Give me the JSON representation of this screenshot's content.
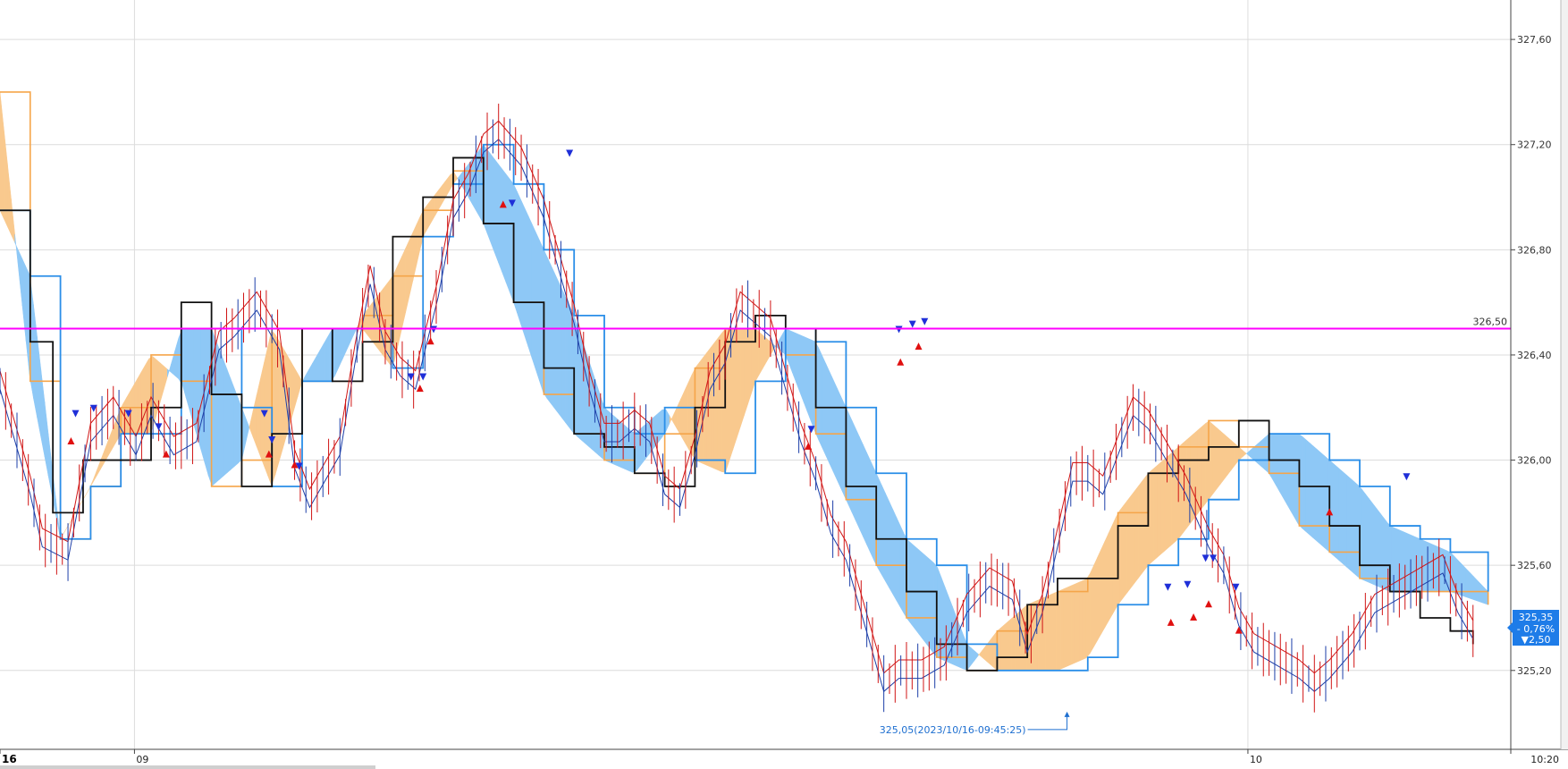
{
  "colors": {
    "grid": "#dcdcdc",
    "kumo_bull": "#f9c98e",
    "kumo_bear": "#8ec8f6",
    "span_a": "#f5a54a",
    "span_b": "#2a8ee8",
    "base_line": "#111111",
    "conversion": "#e01010",
    "price_up": "#d01515",
    "price_down": "#1d3fa8",
    "reference": "#ff00ff",
    "marker_buy": "#e01010",
    "marker_sell": "#1f2fd8",
    "badge_bg": "#1e7ce8",
    "axis": "#444444",
    "annotation": "#1e6fd0"
  },
  "chart_data": {
    "type": "line",
    "y_axis": {
      "ticks": [
        "327,60",
        "327,20",
        "326,80",
        "326,40",
        "326,00",
        "325,60",
        "325,20"
      ],
      "tick_values": [
        327.6,
        327.2,
        326.8,
        326.4,
        326.0,
        325.6,
        325.2
      ],
      "range": [
        324.9,
        327.75
      ]
    },
    "x_axis": {
      "labels": [
        {
          "text": "16",
          "pos": 0.0,
          "bold": true
        },
        {
          "text": "09",
          "pos": 0.089
        },
        {
          "text": "10",
          "pos": 0.826
        },
        {
          "text": "10:20",
          "pos": 1.0
        }
      ]
    },
    "reference_line": {
      "value": 326.5,
      "label": "326,50"
    },
    "low_annotation": {
      "text": "325,05(2023/10/16-09:45:25)",
      "value": 325.05,
      "pos": 0.711
    },
    "last_price": {
      "value": "325,35",
      "change_pct": "- 0,76%",
      "change": "▼2,50"
    },
    "series": [
      {
        "role": "price",
        "x": [
          0.0,
          0.02,
          0.028,
          0.045,
          0.06,
          0.075,
          0.09,
          0.1,
          0.115,
          0.13,
          0.145,
          0.155,
          0.17,
          0.185,
          0.195,
          0.205,
          0.215,
          0.225,
          0.235,
          0.245,
          0.255,
          0.265,
          0.275,
          0.29,
          0.3,
          0.31,
          0.32,
          0.33,
          0.345,
          0.36,
          0.37,
          0.38,
          0.39,
          0.4,
          0.41,
          0.42,
          0.43,
          0.44,
          0.45,
          0.46,
          0.47,
          0.48,
          0.49,
          0.5,
          0.51,
          0.52,
          0.53,
          0.54,
          0.55,
          0.56,
          0.575,
          0.585,
          0.595,
          0.61,
          0.625,
          0.64,
          0.655,
          0.67,
          0.68,
          0.69,
          0.7,
          0.71,
          0.72,
          0.73,
          0.74,
          0.75,
          0.76,
          0.775,
          0.785,
          0.8,
          0.81,
          0.82,
          0.83,
          0.845,
          0.86,
          0.87,
          0.88,
          0.895,
          0.91,
          0.925,
          0.94,
          0.955,
          0.965,
          0.975
        ],
        "y": [
          326.3,
          325.9,
          325.7,
          325.65,
          326.1,
          326.2,
          326.05,
          326.2,
          326.05,
          326.1,
          326.45,
          326.5,
          326.6,
          326.45,
          326.0,
          325.85,
          325.95,
          326.05,
          326.4,
          326.7,
          326.45,
          326.35,
          326.3,
          326.65,
          326.95,
          327.05,
          327.2,
          327.25,
          327.15,
          326.95,
          326.75,
          326.55,
          326.3,
          326.1,
          326.1,
          326.15,
          326.1,
          325.9,
          325.85,
          326.05,
          326.3,
          326.4,
          326.6,
          326.55,
          326.5,
          326.3,
          326.1,
          325.95,
          325.75,
          325.65,
          325.35,
          325.15,
          325.2,
          325.2,
          325.25,
          325.45,
          325.55,
          325.5,
          325.3,
          325.45,
          325.7,
          325.95,
          325.95,
          325.9,
          326.05,
          326.2,
          326.15,
          326.0,
          325.9,
          325.7,
          325.6,
          325.4,
          325.3,
          325.25,
          325.2,
          325.15,
          325.2,
          325.3,
          325.45,
          325.5,
          325.55,
          325.6,
          325.45,
          325.35
        ]
      },
      {
        "role": "base_line",
        "x": [
          0.0,
          0.02,
          0.035,
          0.055,
          0.08,
          0.1,
          0.12,
          0.14,
          0.16,
          0.18,
          0.2,
          0.22,
          0.24,
          0.26,
          0.28,
          0.3,
          0.32,
          0.34,
          0.36,
          0.38,
          0.4,
          0.42,
          0.44,
          0.46,
          0.48,
          0.5,
          0.52,
          0.54,
          0.56,
          0.58,
          0.6,
          0.62,
          0.64,
          0.66,
          0.68,
          0.7,
          0.72,
          0.74,
          0.76,
          0.78,
          0.8,
          0.82,
          0.84,
          0.86,
          0.88,
          0.9,
          0.92,
          0.94,
          0.96,
          0.975
        ],
        "y": [
          326.95,
          326.45,
          325.8,
          326.0,
          326.0,
          326.2,
          326.6,
          326.25,
          325.9,
          326.1,
          326.5,
          326.3,
          326.45,
          326.85,
          327.0,
          327.15,
          326.9,
          326.6,
          326.35,
          326.1,
          326.05,
          325.95,
          325.9,
          326.2,
          326.45,
          326.55,
          326.5,
          326.2,
          325.9,
          325.7,
          325.5,
          325.3,
          325.2,
          325.25,
          325.45,
          325.55,
          325.55,
          325.75,
          325.95,
          326.0,
          326.05,
          326.15,
          326.0,
          325.9,
          325.75,
          325.6,
          325.5,
          325.4,
          325.35,
          325.3
        ]
      },
      {
        "role": "span_a",
        "x": [
          0.0,
          0.02,
          0.04,
          0.06,
          0.08,
          0.1,
          0.12,
          0.14,
          0.16,
          0.18,
          0.2,
          0.22,
          0.24,
          0.26,
          0.28,
          0.3,
          0.32,
          0.34,
          0.36,
          0.38,
          0.4,
          0.42,
          0.44,
          0.46,
          0.48,
          0.5,
          0.52,
          0.54,
          0.56,
          0.58,
          0.6,
          0.62,
          0.64,
          0.66,
          0.68,
          0.7,
          0.72,
          0.74,
          0.76,
          0.78,
          0.8,
          0.82,
          0.84,
          0.86,
          0.88,
          0.9,
          0.92,
          0.94,
          0.96,
          0.985
        ],
        "y": [
          327.4,
          326.3,
          325.7,
          325.9,
          326.2,
          326.4,
          326.3,
          325.9,
          326.0,
          326.5,
          326.3,
          326.3,
          326.55,
          326.7,
          326.95,
          327.1,
          326.9,
          326.6,
          326.25,
          326.1,
          326.0,
          325.95,
          326.1,
          326.35,
          326.5,
          326.5,
          326.4,
          326.1,
          325.85,
          325.6,
          325.4,
          325.25,
          325.2,
          325.35,
          325.45,
          325.5,
          325.55,
          325.8,
          325.95,
          326.05,
          326.15,
          326.05,
          325.95,
          325.75,
          325.65,
          325.55,
          325.5,
          325.5,
          325.5,
          325.45
        ]
      },
      {
        "role": "span_b",
        "x": [
          0.0,
          0.02,
          0.04,
          0.06,
          0.08,
          0.1,
          0.12,
          0.14,
          0.16,
          0.18,
          0.2,
          0.22,
          0.24,
          0.26,
          0.28,
          0.3,
          0.32,
          0.34,
          0.36,
          0.38,
          0.4,
          0.42,
          0.44,
          0.46,
          0.48,
          0.5,
          0.52,
          0.54,
          0.56,
          0.58,
          0.6,
          0.62,
          0.64,
          0.66,
          0.68,
          0.7,
          0.72,
          0.74,
          0.76,
          0.78,
          0.8,
          0.82,
          0.84,
          0.86,
          0.88,
          0.9,
          0.92,
          0.94,
          0.96,
          0.985
        ],
        "y": [
          326.95,
          326.7,
          325.7,
          325.9,
          326.1,
          326.1,
          326.5,
          326.5,
          326.2,
          325.9,
          326.3,
          326.5,
          326.5,
          326.35,
          326.85,
          327.05,
          327.2,
          327.05,
          326.8,
          326.55,
          326.2,
          326.1,
          326.2,
          326.0,
          325.95,
          326.3,
          326.5,
          326.45,
          326.2,
          325.95,
          325.7,
          325.6,
          325.3,
          325.2,
          325.2,
          325.2,
          325.25,
          325.45,
          325.6,
          325.7,
          325.85,
          326.0,
          326.1,
          326.1,
          326.0,
          325.9,
          325.75,
          325.7,
          325.65,
          325.5
        ]
      }
    ],
    "markers_buy": [
      {
        "pos": 0.047,
        "value": 326.07
      },
      {
        "pos": 0.11,
        "value": 326.02
      },
      {
        "pos": 0.178,
        "value": 326.02
      },
      {
        "pos": 0.195,
        "value": 325.98
      },
      {
        "pos": 0.278,
        "value": 326.27
      },
      {
        "pos": 0.285,
        "value": 326.45
      },
      {
        "pos": 0.333,
        "value": 326.97
      },
      {
        "pos": 0.535,
        "value": 326.05
      },
      {
        "pos": 0.596,
        "value": 326.37
      },
      {
        "pos": 0.608,
        "value": 326.43
      },
      {
        "pos": 0.775,
        "value": 325.38
      },
      {
        "pos": 0.79,
        "value": 325.4
      },
      {
        "pos": 0.8,
        "value": 325.45
      },
      {
        "pos": 0.82,
        "value": 325.35
      },
      {
        "pos": 0.88,
        "value": 325.8
      }
    ],
    "markers_sell": [
      {
        "pos": 0.05,
        "value": 326.18
      },
      {
        "pos": 0.062,
        "value": 326.2
      },
      {
        "pos": 0.085,
        "value": 326.18
      },
      {
        "pos": 0.105,
        "value": 326.13
      },
      {
        "pos": 0.175,
        "value": 326.18
      },
      {
        "pos": 0.18,
        "value": 326.08
      },
      {
        "pos": 0.198,
        "value": 325.98
      },
      {
        "pos": 0.272,
        "value": 326.32
      },
      {
        "pos": 0.28,
        "value": 326.32
      },
      {
        "pos": 0.287,
        "value": 326.5
      },
      {
        "pos": 0.339,
        "value": 326.98
      },
      {
        "pos": 0.377,
        "value": 327.17
      },
      {
        "pos": 0.537,
        "value": 326.12
      },
      {
        "pos": 0.595,
        "value": 326.5
      },
      {
        "pos": 0.604,
        "value": 326.52
      },
      {
        "pos": 0.612,
        "value": 326.53
      },
      {
        "pos": 0.773,
        "value": 325.52
      },
      {
        "pos": 0.786,
        "value": 325.53
      },
      {
        "pos": 0.798,
        "value": 325.63
      },
      {
        "pos": 0.803,
        "value": 325.63
      },
      {
        "pos": 0.818,
        "value": 325.52
      },
      {
        "pos": 0.931,
        "value": 325.94
      }
    ]
  }
}
